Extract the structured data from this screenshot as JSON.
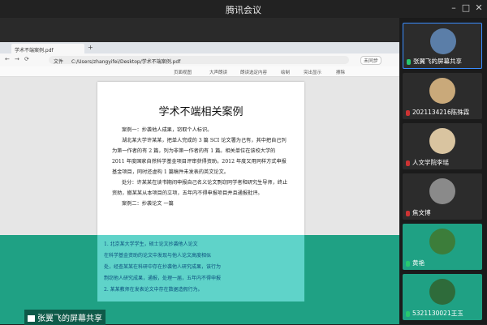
{
  "window": {
    "title": "腾讯会议"
  },
  "browser": {
    "tab_title": "学术不端案例.pdf",
    "url": "C:/Users/zhangyifei/Desktop/学术不端案例.pdf",
    "url_prefix": "文件",
    "signin": "未同步"
  },
  "pdf_toolbar": {
    "items": [
      "页面视图",
      "大声朗读",
      "朗读选定内容",
      "绘制",
      "突出显示",
      "擦除"
    ]
  },
  "document": {
    "title": "学术不端相关案例",
    "paragraphs": [
      "案例一：抄袭他人成果，窃取个人标识。",
      "湖北某大学许某某，把单人完成的 3 篇 SCI 论文署为己有，其中把自己列为第一作者的有 2 篇，列为非第一作者的有 1 篇。相关单位在该校大学的 2011 年度国家自然科学基金项目评审获得资助。2012 年度又用同样方式申报基金项目，同时还虚构 1 篇稿件未发表的英文论文。",
      "处分：许某某在读书期间申报自己名义论文剽窃同学者和研究生导师，终止资助，撤某某从本项目的立项，五年内不得申报项目并且通报批评。",
      "案例二：抄袭论文 一篇"
    ],
    "teal_lines": [
      "1. 北京某大学学生，硕士论文抄袭他人论文",
      "在科学基金资助的论文中发现与他人论文高度相似",
      "处，经查某某在科研中存在抄袭他人研究成果，该行为",
      "剽窃他人研究成果，通报，处理一届，五年内不得申报",
      "2. 某某教师在发表论文中存在数据造假行为。"
    ]
  },
  "screen_share_label": "张翼飞的屏幕共享",
  "participants": [
    {
      "name": "张翼飞的屏幕共享",
      "mic": "on",
      "active": true
    },
    {
      "name": "2021134216陈殊霖",
      "mic": "muted",
      "active": false
    },
    {
      "name": "人文学院李瑶",
      "mic": "muted",
      "active": false
    },
    {
      "name": "焦文博",
      "mic": "muted",
      "active": false
    },
    {
      "name": "黄艳",
      "mic": "on",
      "active": false
    },
    {
      "name": "5321130021王玉",
      "mic": "on",
      "active": false
    }
  ]
}
